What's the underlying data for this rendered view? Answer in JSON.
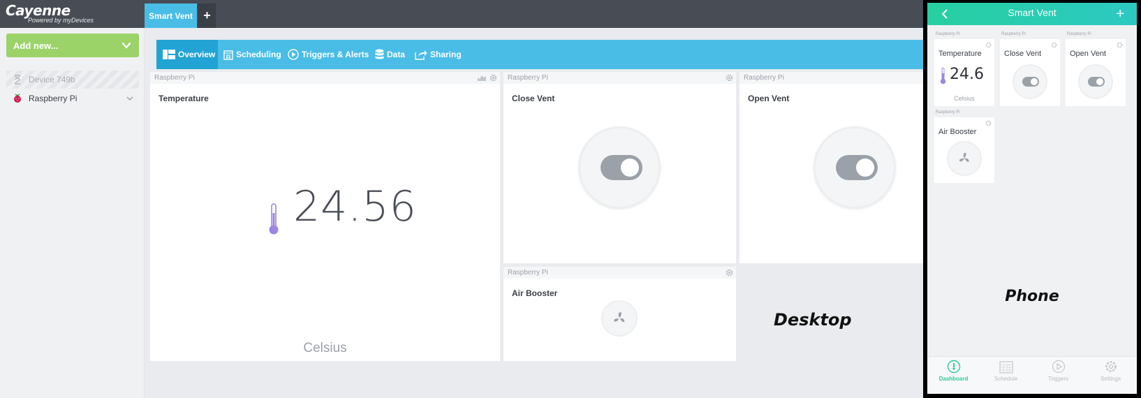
{
  "app": {
    "name": "Cayenne",
    "tagline": "Powered by myDevices"
  },
  "tabs": {
    "active": "Smart Vent",
    "add": "+"
  },
  "sidebar": {
    "add_new": "Add new...",
    "devices": [
      {
        "label": "Device 749b"
      },
      {
        "label": "Raspberry Pi"
      }
    ]
  },
  "nav": {
    "overview": "Overview",
    "scheduling": "Scheduling",
    "triggers": "Triggers & Alerts",
    "data": "Data",
    "sharing": "Sharing"
  },
  "widgets": {
    "temperature": {
      "device": "Raspberry Pi",
      "title": "Temperature",
      "value": "24.56",
      "unit": "Celsius"
    },
    "close_vent": {
      "device": "Raspberry Pi",
      "title": "Close Vent",
      "state": "on"
    },
    "open_vent": {
      "device": "Raspberry Pi",
      "title": "Open Vent",
      "state": "on"
    },
    "air_booster": {
      "device": "Raspberry Pi",
      "title": "Air Booster"
    }
  },
  "labels": {
    "desktop": "Desktop",
    "phone": "Phone"
  },
  "phone": {
    "title": "Smart Vent",
    "back_icon": "chevron-left-icon",
    "add": "+",
    "cards": {
      "temperature": {
        "device": "Raspberry Pi",
        "title": "Temperature",
        "value": "24.6",
        "unit": "Celsius"
      },
      "close_vent": {
        "device": "Raspberry Pi",
        "title": "Close Vent"
      },
      "open_vent": {
        "device": "Raspberry Pi",
        "title": "Open Vent"
      },
      "air_booster": {
        "device": "Raspberry Pi",
        "title": "Air Booster"
      }
    },
    "footer": [
      {
        "label": "Dashboard",
        "active": true
      },
      {
        "label": "Schedule",
        "active": false
      },
      {
        "label": "Triggers",
        "active": false
      },
      {
        "label": "Settings",
        "active": false
      }
    ]
  },
  "colors": {
    "topbar": "#474c55",
    "accent": "#49bde6",
    "add_new": "#9bd368",
    "thermo": "#9c86e0",
    "phone_accent": "#2cc99b"
  }
}
